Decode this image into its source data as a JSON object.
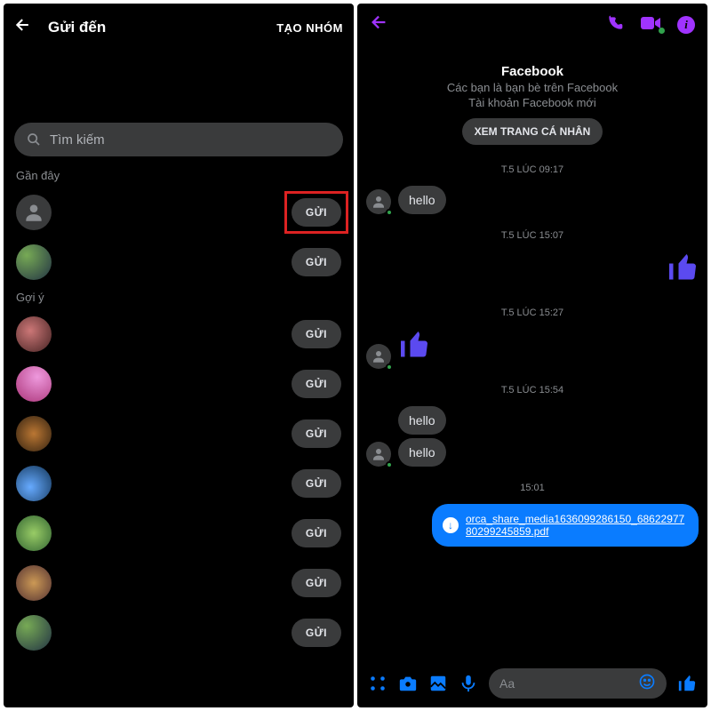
{
  "left": {
    "title": "Gửi đến",
    "create_group": "TẠO NHÓM",
    "search_placeholder": "Tìm kiếm",
    "section_recent": "Gần đây",
    "section_suggest": "Gợi ý",
    "send_label": "GỬI"
  },
  "right": {
    "profile_name": "Facebook",
    "profile_line1": "Các bạn là bạn bè trên Facebook",
    "profile_line2": "Tài khoản Facebook mới",
    "view_profile": "XEM TRANG CÁ NHÂN",
    "times": {
      "t1": "T.5 LÚC 09:17",
      "t2": "T.5 LÚC 15:07",
      "t3": "T.5 LÚC 15:27",
      "t4": "T.5 LÚC 15:54",
      "t5": "15:01"
    },
    "msg_hello": "hello",
    "file_name": "orca_share_media1636099286150_6862297780299245859.pdf",
    "input_placeholder": "Aa"
  }
}
